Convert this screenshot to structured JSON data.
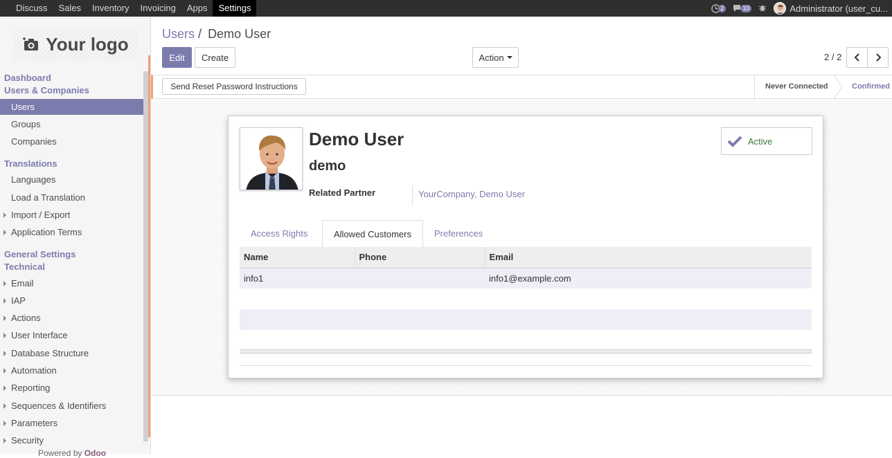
{
  "topnav": {
    "items": [
      "Discuss",
      "Sales",
      "Inventory",
      "Invoicing",
      "Apps",
      "Settings"
    ],
    "active": "Settings",
    "activity_count": "2",
    "message_count": "10",
    "user": "Administrator (user_cu..."
  },
  "sidebar": {
    "logo_text": "Your logo",
    "sections": {
      "dashboard": "Dashboard",
      "users_companies": "Users & Companies",
      "translations": "Translations",
      "general_settings": "General Settings",
      "technical": "Technical"
    },
    "users_items": [
      "Users",
      "Groups",
      "Companies"
    ],
    "translation_items": [
      "Languages",
      "Load a Translation",
      "Import / Export",
      "Application Terms"
    ],
    "technical_items": [
      "Email",
      "IAP",
      "Actions",
      "User Interface",
      "Database Structure",
      "Automation",
      "Reporting",
      "Sequences & Identifiers",
      "Parameters",
      "Security"
    ],
    "powered_prefix": "Powered by",
    "powered_brand": "Odoo"
  },
  "breadcrumb": {
    "parent": "Users",
    "separator": "/",
    "current": "Demo User"
  },
  "buttons": {
    "edit": "Edit",
    "create": "Create",
    "action": "Action",
    "reset_password": "Send Reset Password Instructions"
  },
  "pager": {
    "value": "2 / 2"
  },
  "status": {
    "stages": [
      "Never Connected",
      "Confirmed"
    ],
    "current": "Confirmed"
  },
  "record": {
    "name": "Demo User",
    "login": "demo",
    "related_partner_label": "Related Partner",
    "related_partner_value": "YourCompany, Demo User",
    "active_label": "Active"
  },
  "tabs": [
    "Access Rights",
    "Allowed Customers",
    "Preferences"
  ],
  "active_tab": "Allowed Customers",
  "table": {
    "columns": [
      "Name",
      "Phone",
      "Email"
    ],
    "rows": [
      {
        "name": "info1",
        "phone": "",
        "email": "info1@example.com"
      }
    ]
  },
  "colors": {
    "brand": "#7c7bad",
    "topbar": "#2f2f2f",
    "accent": "#f0a17a",
    "active_green": "#3c763d"
  }
}
